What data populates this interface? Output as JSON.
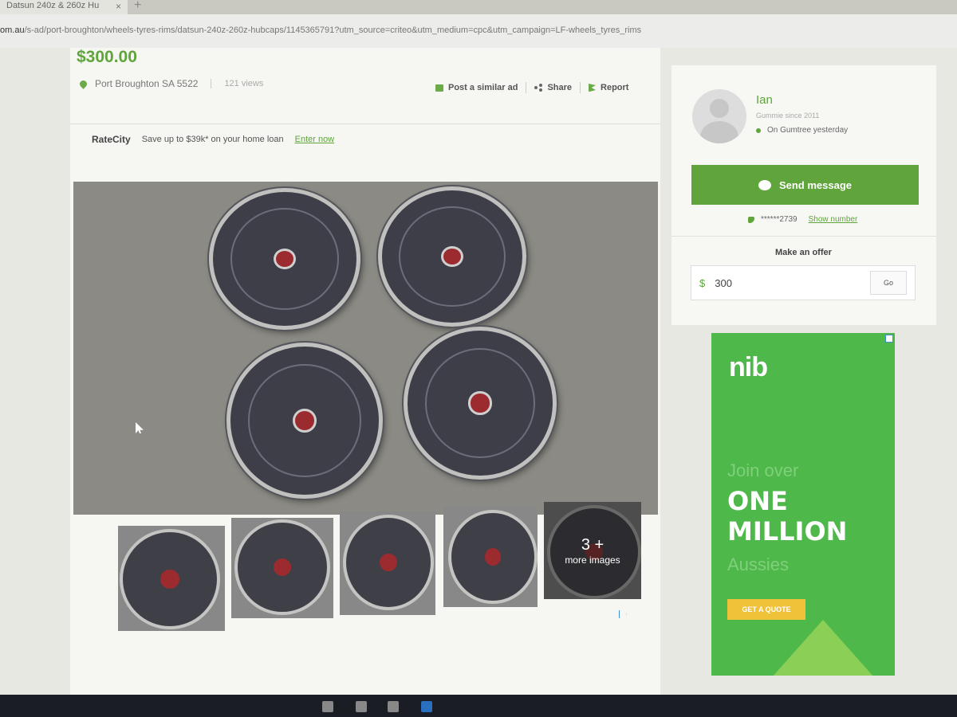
{
  "browser": {
    "tab_title": "Datsun 240z & 260z Hu",
    "tab_close": "×",
    "new_tab": "+",
    "url_host": "om.au",
    "url_path": "/s-ad/port-broughton/wheels-tyres-rims/datsun-240z-260z-hubcaps/1145365791?utm_source=criteo&utm_medium=cpc&utm_campaign=LF-wheels_tyres_rims"
  },
  "listing": {
    "price": "$300.00",
    "location": "Port Broughton SA 5522",
    "views": "121 views",
    "actions": {
      "post_similar": "Post a similar ad",
      "share": "Share",
      "report": "Report"
    },
    "promo": {
      "brand": "RateCity",
      "text": "Save up to $39k* on your home loan",
      "link": "Enter now"
    },
    "more_images": {
      "count": "3 +",
      "label": "more images"
    }
  },
  "seller": {
    "name": "Ian",
    "since": "Gummie since 2011",
    "status": "On Gumtree yesterday",
    "send_message": "Send message",
    "phone": "******2739",
    "show_number": "Show number"
  },
  "offer": {
    "label": "Make an offer",
    "currency": "$",
    "value": "300",
    "go": "Go"
  },
  "ad": {
    "logo": "nib",
    "join": "Join over",
    "line1": "ONE",
    "line2": "MILLION",
    "aussies": "Aussies",
    "cta": "GET A QUOTE"
  },
  "colors": {
    "accent": "#5fa53b",
    "ad_green": "#4fb84a",
    "cta_yellow": "#f0c23a"
  }
}
